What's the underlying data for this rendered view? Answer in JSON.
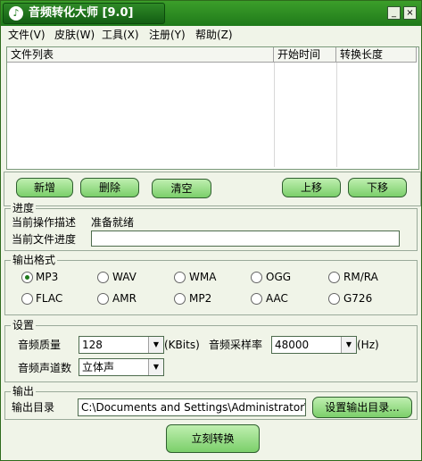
{
  "title": "音频转化大师 [9.0]",
  "title_buttons": {
    "minimize": "_",
    "close": "×"
  },
  "menu": [
    {
      "label": "文件(V)"
    },
    {
      "label": "皮肤(W)"
    },
    {
      "label": "工具(X)"
    },
    {
      "label": "注册(Y)"
    },
    {
      "label": "帮助(Z)"
    }
  ],
  "file_list": {
    "columns": [
      "文件列表",
      "开始时间",
      "转换长度"
    ]
  },
  "buttons": {
    "add": "新增",
    "delete": "删除",
    "clear": "清空",
    "move_up": "上移",
    "move_down": "下移",
    "set_output_dir": "设置输出目录...",
    "convert_now": "立刻转换"
  },
  "progress": {
    "group_label": "进度",
    "current_op_label": "当前操作描述",
    "current_op_value": "准备就绪",
    "file_progress_label": "当前文件进度",
    "file_progress_value": 0
  },
  "output_format": {
    "group_label": "输出格式",
    "options": [
      "MP3",
      "WAV",
      "WMA",
      "OGG",
      "RM/RA",
      "FLAC",
      "AMR",
      "MP2",
      "AAC",
      "G726"
    ],
    "selected": "MP3"
  },
  "settings": {
    "group_label": "设置",
    "quality_label": "音频质量",
    "quality_value": "128",
    "quality_unit": "(KBits)",
    "sample_rate_label": "音频采样率",
    "sample_rate_value": "48000",
    "sample_rate_unit": "(Hz)",
    "channels_label": "音频声道数",
    "channels_value": "立体声"
  },
  "output": {
    "group_label": "输出",
    "dir_label": "输出目录",
    "dir_value": "C:\\Documents and Settings\\Administrator\\桌面"
  },
  "colors": {
    "title_bar": "#1f7a1a",
    "button": "#9fe08e",
    "window_bg": "#f0f4e8"
  },
  "icons": {
    "app": "music-disc-icon",
    "dropdown": "chevron-down-icon"
  }
}
